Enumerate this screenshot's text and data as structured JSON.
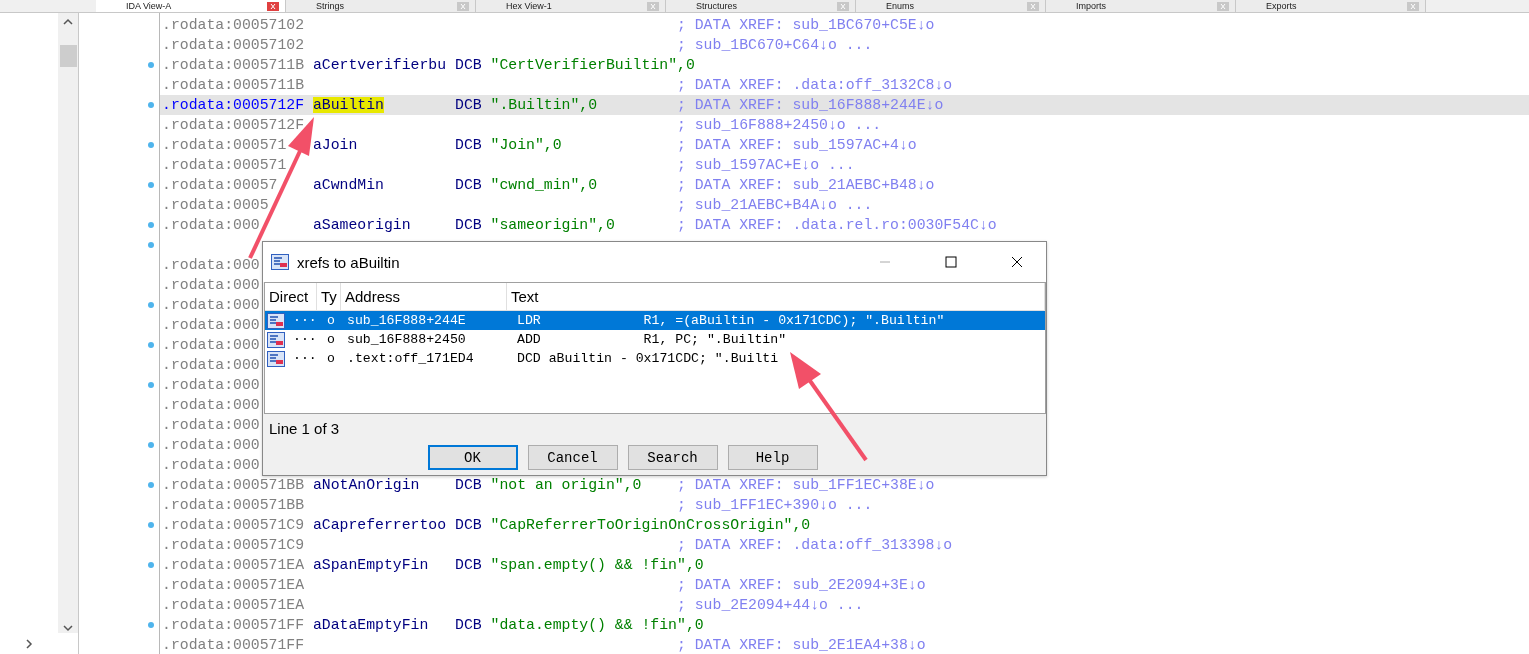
{
  "tabs": [
    {
      "label": "IDA View-A",
      "selected": true
    },
    {
      "label": "Strings",
      "selected": false
    },
    {
      "label": "Hex View-1",
      "selected": false
    },
    {
      "label": "Structures",
      "selected": false
    },
    {
      "label": "Enums",
      "selected": false
    },
    {
      "label": "Imports",
      "selected": false
    },
    {
      "label": "Exports",
      "selected": false
    }
  ],
  "disassembly": {
    "lines": [
      {
        "address": ".rodata:00057102",
        "comment": "; DATA XREF: sub_1BC670+C5E↓o",
        "marked": false,
        "selected": false
      },
      {
        "address": ".rodata:00057102",
        "comment": "; sub_1BC670+C64↓o ...",
        "marked": false,
        "selected": false
      },
      {
        "address": ".rodata:0005711B",
        "name": "aCertverifierbu",
        "op": "DCB",
        "operand": "\"CertVerifierBuiltin\",0",
        "marked": true,
        "selected": false
      },
      {
        "address": ".rodata:0005711B",
        "comment": "; DATA XREF: .data:off_3132C8↓o",
        "marked": false,
        "selected": false
      },
      {
        "address": ".rodata:0005712F",
        "name": "aBuiltin",
        "op": "DCB",
        "operand": "\".Builtin\",0",
        "comment": "; DATA XREF: sub_16F888+244E↓o",
        "marked": true,
        "selected": true
      },
      {
        "address": ".rodata:0005712F",
        "comment": "; sub_16F888+2450↓o ...",
        "marked": false,
        "selected": false
      },
      {
        "address": ".rodata:000571",
        "name": "aJoin",
        "op": "DCB",
        "operand": "\"Join\",0",
        "comment": "; DATA XREF: sub_1597AC+4↓o",
        "marked": true,
        "selected": false
      },
      {
        "address": ".rodata:000571",
        "comment": "; sub_1597AC+E↓o ...",
        "marked": false,
        "selected": false
      },
      {
        "address": ".rodata:00057",
        "name": "aCwndMin",
        "op": "DCB",
        "operand": "\"cwnd_min\",0",
        "comment": "; DATA XREF: sub_21AEBC+B48↓o",
        "marked": true,
        "selected": false
      },
      {
        "address": ".rodata:0005",
        "comment": "; sub_21AEBC+B4A↓o ...",
        "marked": false,
        "selected": false
      },
      {
        "address": ".rodata:000",
        "name": "aSameorigin",
        "op": "DCB",
        "operand": "\"sameorigin\",0",
        "comment": "; DATA XREF: .data.rel.ro:0030F54C↓o",
        "marked": true,
        "selected": false
      },
      {
        "marked": true,
        "selected": false
      },
      {
        "address": ".rodata:000",
        "marked": false,
        "selected": false
      },
      {
        "address": ".rodata:000",
        "marked": false,
        "selected": false
      },
      {
        "address": ".rodata:000",
        "marked": true,
        "selected": false
      },
      {
        "address": ".rodata:000",
        "marked": false,
        "selected": false
      },
      {
        "address": ".rodata:000",
        "marked": true,
        "selected": false
      },
      {
        "address": ".rodata:000",
        "marked": false,
        "selected": false
      },
      {
        "address": ".rodata:000",
        "marked": true,
        "selected": false
      },
      {
        "address": ".rodata:000",
        "marked": false,
        "selected": false
      },
      {
        "address": ".rodata:000",
        "marked": false,
        "selected": false
      },
      {
        "address": ".rodata:000",
        "marked": true,
        "selected": false
      },
      {
        "address": ".rodata:000",
        "marked": false,
        "selected": false
      },
      {
        "address": ".rodata:000571BB",
        "name": "aNotAnOrigin",
        "op": "DCB",
        "operand": "\"not an origin\",0",
        "comment": "; DATA XREF: sub_1FF1EC+38E↓o",
        "marked": true,
        "selected": false
      },
      {
        "address": ".rodata:000571BB",
        "comment": "; sub_1FF1EC+390↓o ...",
        "marked": false,
        "selected": false
      },
      {
        "address": ".rodata:000571C9",
        "name": "aCapreferrertoo",
        "op": "DCB",
        "operand": "\"CapReferrerToOriginOnCrossOrigin\",0",
        "marked": true,
        "selected": false
      },
      {
        "address": ".rodata:000571C9",
        "comment": "; DATA XREF: .data:off_313398↓o",
        "marked": false,
        "selected": false
      },
      {
        "address": ".rodata:000571EA",
        "name": "aSpanEmptyFin",
        "op": "DCB",
        "operand": "\"span.empty() && !fin\",0",
        "marked": true,
        "selected": false
      },
      {
        "address": ".rodata:000571EA",
        "comment": "; DATA XREF: sub_2E2094+3E↓o",
        "marked": false,
        "selected": false
      },
      {
        "address": ".rodata:000571EA",
        "comment": "; sub_2E2094+44↓o ...",
        "marked": false,
        "selected": false
      },
      {
        "address": ".rodata:000571FF",
        "name": "aDataEmptyFin",
        "op": "DCB",
        "operand": "\"data.empty() && !fin\",0",
        "marked": true,
        "selected": false
      },
      {
        "address": ".rodata:000571FF",
        "comment": "; DATA XREF: sub_2E1EA4+38↓o",
        "marked": false,
        "selected": false
      }
    ]
  },
  "dialog": {
    "title": "xrefs to aBuiltin",
    "columns": [
      "Direct",
      "Ty",
      "Address",
      "Text"
    ],
    "rows": [
      {
        "direction": "···",
        "type": "o",
        "address": "sub_16F888+244E",
        "text": "LDR             R1, =(aBuiltin - 0x171CDC); \".Builtin\"",
        "selected": true
      },
      {
        "direction": "···",
        "type": "o",
        "address": "sub_16F888+2450",
        "text": "ADD             R1, PC; \".Builtin\"",
        "selected": false
      },
      {
        "direction": "···",
        "type": "o",
        "address": ".text:off_171ED4",
        "text": "DCD aBuiltin - 0x171CDC; \".Builti",
        "selected": false
      }
    ],
    "status": "Line 1 of 3",
    "buttons": [
      {
        "label": "OK",
        "default": true
      },
      {
        "label": "Cancel",
        "default": false
      },
      {
        "label": "Search",
        "default": false
      },
      {
        "label": "Help",
        "default": false
      }
    ]
  }
}
